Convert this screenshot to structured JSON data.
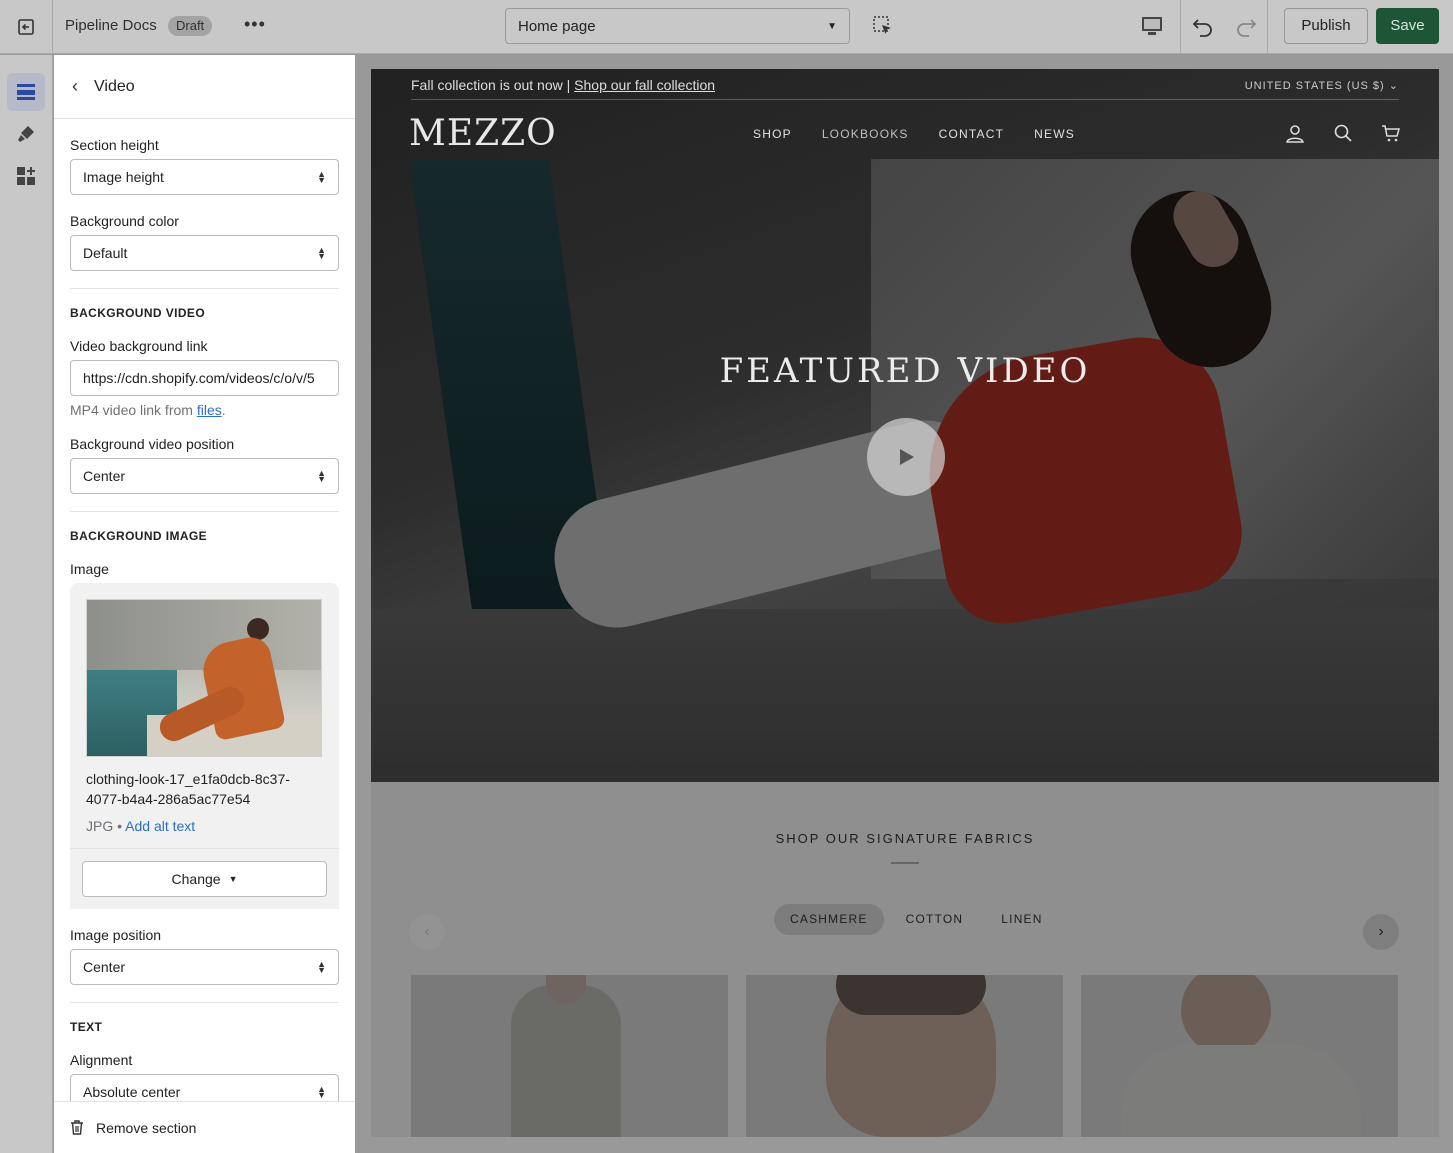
{
  "topbar": {
    "store_name": "Pipeline Docs",
    "status_badge": "Draft",
    "page_selector": "Home page",
    "publish_label": "Publish",
    "save_label": "Save"
  },
  "panel": {
    "title": "Video",
    "section_height_label": "Section height",
    "section_height_value": "Image height",
    "bg_color_label": "Background color",
    "bg_color_value": "Default",
    "bg_video_heading": "BACKGROUND VIDEO",
    "video_link_label": "Video background link",
    "video_link_value": "https://cdn.shopify.com/videos/c/o/v/5",
    "video_link_help_prefix": "MP4 video link from",
    "video_link_help_link": "files",
    "video_position_label": "Background video position",
    "video_position_value": "Center",
    "bg_image_heading": "BACKGROUND IMAGE",
    "image_label": "Image",
    "image_filename": "clothing-look-17_e1fa0dcb-8c37-4077-b4a4-286a5ac77e54",
    "image_type": "JPG",
    "add_alt_text": "Add alt text",
    "change_label": "Change",
    "image_position_label": "Image position",
    "image_position_value": "Center",
    "text_heading": "TEXT",
    "alignment_label": "Alignment",
    "alignment_value": "Absolute center",
    "remove_section": "Remove section"
  },
  "preview": {
    "announcement_text": "Fall collection is out now |",
    "announcement_link": "Shop our fall collection",
    "country": "UNITED STATES (US $)",
    "logo": "MEZZO",
    "nav": [
      "SHOP",
      "LOOKBOOKS",
      "CONTACT",
      "NEWS"
    ],
    "hero_title": "FEATURED VIDEO",
    "fabrics_title": "SHOP OUR SIGNATURE FABRICS",
    "fabric_tabs": [
      "CASHMERE",
      "COTTON",
      "LINEN"
    ]
  },
  "colors": {
    "save_button": "#1d5537",
    "link": "#2c6ecb",
    "rail_active": "#b6b9c8"
  },
  "icons": [
    "exit-icon",
    "more-icon",
    "inspector-icon",
    "desktop-icon",
    "undo-icon",
    "redo-icon",
    "sections-icon",
    "theme-settings-icon",
    "apps-icon",
    "back-chevron-icon",
    "trash-icon",
    "account-icon",
    "search-icon",
    "cart-icon",
    "play-icon"
  ]
}
